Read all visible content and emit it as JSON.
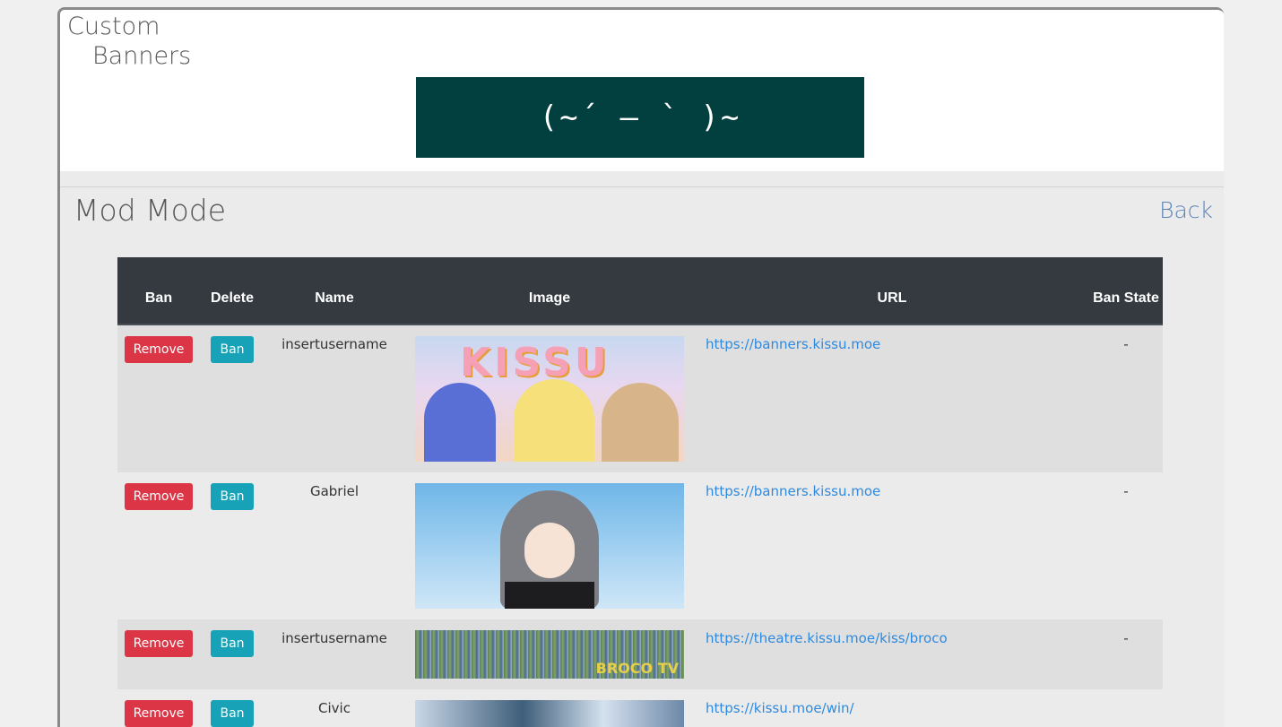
{
  "header": {
    "title_line1": "Custom",
    "title_line2": "Banners",
    "banner_text": "(~´ — ` )~"
  },
  "mod": {
    "title": "Mod Mode",
    "back_label": "Back"
  },
  "table": {
    "columns": {
      "ban": "Ban",
      "delete": "Delete",
      "name": "Name",
      "image": "Image",
      "url": "URL",
      "ban_state": "Ban State"
    },
    "rows": [
      {
        "remove_label": "Remove",
        "ban_label": "Ban",
        "name": "insertusername",
        "image_text": "KISSU",
        "url": "https://banners.kissu.moe",
        "ban_state": "-"
      },
      {
        "remove_label": "Remove",
        "ban_label": "Ban",
        "name": "Gabriel",
        "image_text": "",
        "url": "https://banners.kissu.moe",
        "ban_state": "-"
      },
      {
        "remove_label": "Remove",
        "ban_label": "Ban",
        "name": "insertusername",
        "image_text": "BROCO TV",
        "url": "https://theatre.kissu.moe/kiss/broco",
        "ban_state": "-"
      },
      {
        "remove_label": "Remove",
        "ban_label": "Ban",
        "name": "Civic",
        "image_text": "",
        "url": "https://kissu.moe/win/",
        "ban_state": ""
      }
    ]
  },
  "colors": {
    "remove_button": "#dc3545",
    "ban_button": "#17a2b8",
    "table_header": "#343a40",
    "link": "#2d8ae0",
    "banner_bg": "#024040"
  }
}
